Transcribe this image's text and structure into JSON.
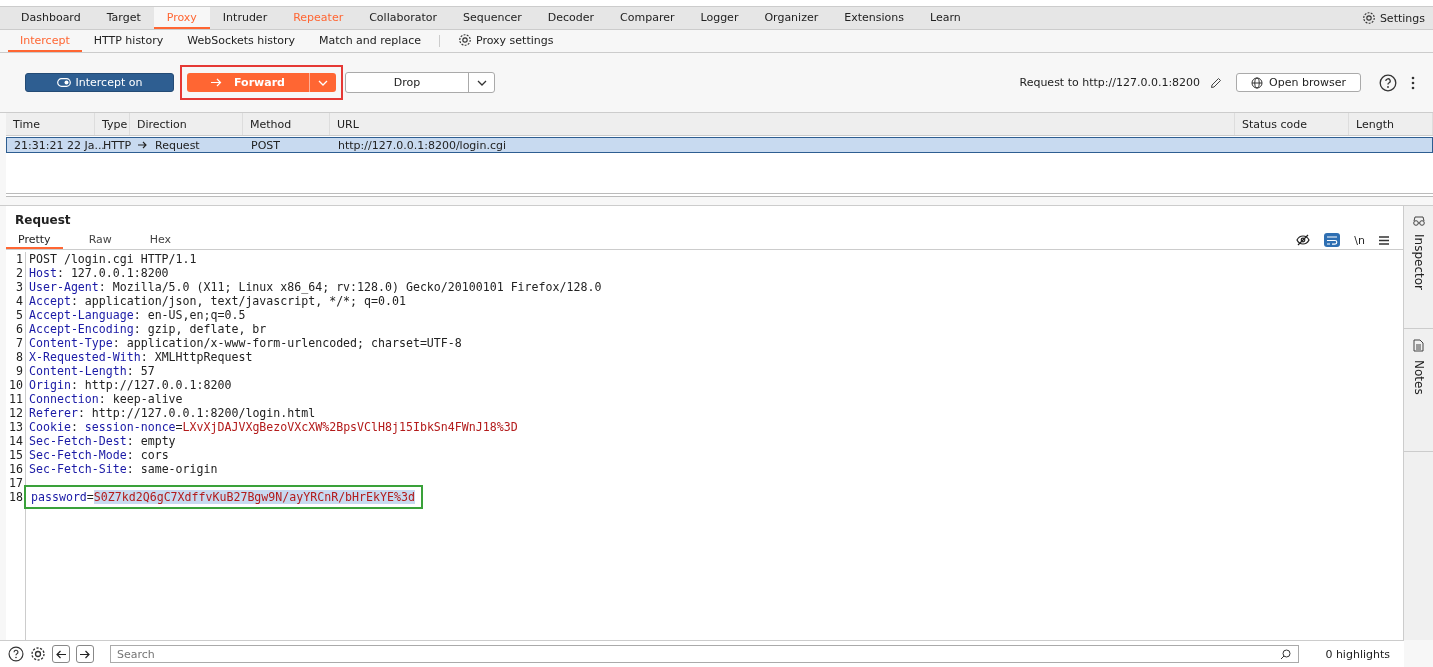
{
  "main_tabs": [
    {
      "label": "Dashboard",
      "selected": false,
      "accent": false
    },
    {
      "label": "Target",
      "selected": false,
      "accent": false
    },
    {
      "label": "Proxy",
      "selected": true,
      "accent": true
    },
    {
      "label": "Intruder",
      "selected": false,
      "accent": false
    },
    {
      "label": "Repeater",
      "selected": false,
      "accent": true
    },
    {
      "label": "Collaborator",
      "selected": false,
      "accent": false
    },
    {
      "label": "Sequencer",
      "selected": false,
      "accent": false
    },
    {
      "label": "Decoder",
      "selected": false,
      "accent": false
    },
    {
      "label": "Comparer",
      "selected": false,
      "accent": false
    },
    {
      "label": "Logger",
      "selected": false,
      "accent": false
    },
    {
      "label": "Organizer",
      "selected": false,
      "accent": false
    },
    {
      "label": "Extensions",
      "selected": false,
      "accent": false
    },
    {
      "label": "Learn",
      "selected": false,
      "accent": false
    }
  ],
  "settings": "Settings",
  "sub_tabs": [
    {
      "label": "Intercept",
      "selected": true
    },
    {
      "label": "HTTP history",
      "selected": false
    },
    {
      "label": "WebSockets history",
      "selected": false
    },
    {
      "label": "Match and replace",
      "selected": false
    }
  ],
  "proxy_settings": "Proxy settings",
  "toolbar": {
    "intercept": {
      "label": "Intercept on",
      "on": true
    },
    "forward": {
      "label": "Forward",
      "outlined": true
    },
    "drop": {
      "label": "Drop"
    },
    "request_to": "Request to http://127.0.0.1:8200",
    "open_browser": "Open browser"
  },
  "table": {
    "columns": [
      "Time",
      "Type",
      "Direction",
      "Method",
      "URL",
      "Status code",
      "Length"
    ],
    "rows": [
      {
        "selected": true,
        "cells": [
          "21:31:21 22 Ja...",
          "HTTP",
          "Request",
          "POST",
          "http://127.0.0.1:8200/login.cgi",
          "",
          ""
        ]
      }
    ]
  },
  "request": {
    "title": "Request",
    "tabs": [
      {
        "label": "Pretty",
        "selected": true
      },
      {
        "label": "Raw",
        "selected": false
      },
      {
        "label": "Hex",
        "selected": false
      }
    ],
    "wrap_on": true,
    "newline_label": "\\n",
    "lines": [
      {
        "number": "1",
        "outlined": false,
        "segments": [
          {
            "kind": "text",
            "text": "POST /login.cgi HTTP/1.1",
            "selected": false
          }
        ]
      },
      {
        "number": "2",
        "outlined": false,
        "segments": [
          {
            "kind": "key",
            "text": "Host",
            "selected": false
          },
          {
            "kind": "text",
            "text": ": 127.0.0.1:8200",
            "selected": false
          }
        ]
      },
      {
        "number": "3",
        "outlined": false,
        "segments": [
          {
            "kind": "key",
            "text": "User-Agent",
            "selected": false
          },
          {
            "kind": "text",
            "text": ": Mozilla/5.0 (X11; Linux x86_64; rv:128.0) Gecko/20100101 Firefox/128.0",
            "selected": false
          }
        ]
      },
      {
        "number": "4",
        "outlined": false,
        "segments": [
          {
            "kind": "key",
            "text": "Accept",
            "selected": false
          },
          {
            "kind": "text",
            "text": ": application/json, text/javascript, */*; q=0.01",
            "selected": false
          }
        ]
      },
      {
        "number": "5",
        "outlined": false,
        "segments": [
          {
            "kind": "key",
            "text": "Accept-Language",
            "selected": false
          },
          {
            "kind": "text",
            "text": ": en-US,en;q=0.5",
            "selected": false
          }
        ]
      },
      {
        "number": "6",
        "outlined": false,
        "segments": [
          {
            "kind": "key",
            "text": "Accept-Encoding",
            "selected": false
          },
          {
            "kind": "text",
            "text": ": gzip, deflate, br",
            "selected": false
          }
        ]
      },
      {
        "number": "7",
        "outlined": false,
        "segments": [
          {
            "kind": "key",
            "text": "Content-Type",
            "selected": false
          },
          {
            "kind": "text",
            "text": ": application/x-www-form-urlencoded; charset=UTF-8",
            "selected": false
          }
        ]
      },
      {
        "number": "8",
        "outlined": false,
        "segments": [
          {
            "kind": "key",
            "text": "X-Requested-With",
            "selected": false
          },
          {
            "kind": "text",
            "text": ": XMLHttpRequest",
            "selected": false
          }
        ]
      },
      {
        "number": "9",
        "outlined": false,
        "segments": [
          {
            "kind": "key",
            "text": "Content-Length",
            "selected": false
          },
          {
            "kind": "text",
            "text": ": 57",
            "selected": false
          }
        ]
      },
      {
        "number": "10",
        "outlined": false,
        "segments": [
          {
            "kind": "key",
            "text": "Origin",
            "selected": false
          },
          {
            "kind": "text",
            "text": ": http://127.0.0.1:8200",
            "selected": false
          }
        ]
      },
      {
        "number": "11",
        "outlined": false,
        "segments": [
          {
            "kind": "key",
            "text": "Connection",
            "selected": false
          },
          {
            "kind": "text",
            "text": ": keep-alive",
            "selected": false
          }
        ]
      },
      {
        "number": "12",
        "outlined": false,
        "segments": [
          {
            "kind": "key",
            "text": "Referer",
            "selected": false
          },
          {
            "kind": "text",
            "text": ": http://127.0.0.1:8200/login.html",
            "selected": false
          }
        ]
      },
      {
        "number": "13",
        "outlined": false,
        "segments": [
          {
            "kind": "key",
            "text": "Cookie",
            "selected": false
          },
          {
            "kind": "text",
            "text": ": ",
            "selected": false
          },
          {
            "kind": "param",
            "text": "session-nonce",
            "selected": false
          },
          {
            "kind": "text",
            "text": "=",
            "selected": false
          },
          {
            "kind": "value",
            "text": "LXvXjDAJVXgBezoVXcXW%2BpsVClH8j15IbkSn4FWnJ18%3D",
            "selected": false
          }
        ]
      },
      {
        "number": "14",
        "outlined": false,
        "segments": [
          {
            "kind": "key",
            "text": "Sec-Fetch-Dest",
            "selected": false
          },
          {
            "kind": "text",
            "text": ": empty",
            "selected": false
          }
        ]
      },
      {
        "number": "15",
        "outlined": false,
        "segments": [
          {
            "kind": "key",
            "text": "Sec-Fetch-Mode",
            "selected": false
          },
          {
            "kind": "text",
            "text": ": cors",
            "selected": false
          }
        ]
      },
      {
        "number": "16",
        "outlined": false,
        "segments": [
          {
            "kind": "key",
            "text": "Sec-Fetch-Site",
            "selected": false
          },
          {
            "kind": "text",
            "text": ": same-origin",
            "selected": false
          }
        ]
      },
      {
        "number": "17",
        "outlined": false
      },
      {
        "number": "18",
        "outlined": true,
        "segments": [
          {
            "kind": "param",
            "text": "password",
            "selected": false
          },
          {
            "kind": "text",
            "text": "=",
            "selected": false
          },
          {
            "kind": "value",
            "text": "S0Z7kd2Q6gC7XdffvKuB27Bgw9N/ayYRCnR/bHrEkYE%3d",
            "selected": true
          }
        ]
      }
    ]
  },
  "side_tabs": [
    "Inspector",
    "Notes"
  ],
  "bottom": {
    "search_placeholder": "Search",
    "highlights": "0 highlights"
  }
}
